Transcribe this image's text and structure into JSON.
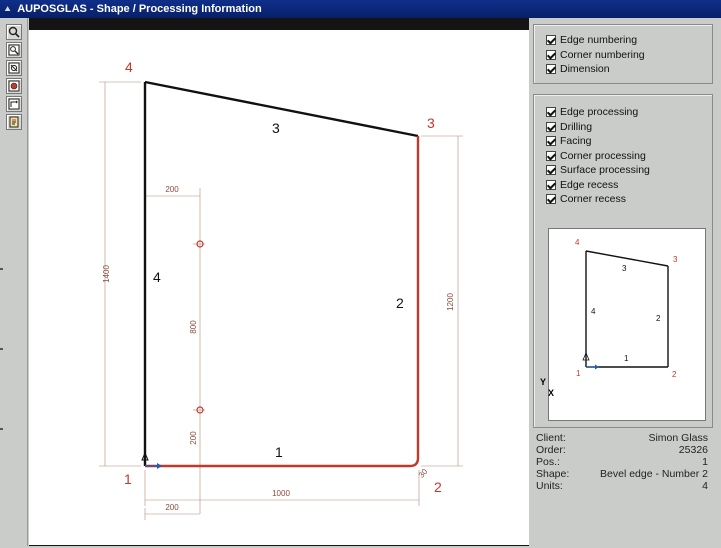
{
  "window": {
    "title": "AUPOSGLAS - Shape / Processing Information"
  },
  "toolbar": {
    "tools": [
      {
        "icon": "zoom-icon"
      },
      {
        "icon": "zoom-window-icon"
      },
      {
        "icon": "zoom-fit-icon"
      },
      {
        "icon": "zoom-shape-icon"
      },
      {
        "icon": "zoom-previous-icon"
      },
      {
        "icon": "print-icon"
      }
    ]
  },
  "drawing": {
    "corner_labels": [
      "1",
      "2",
      "3",
      "4"
    ],
    "edge_labels": [
      "1",
      "2",
      "3",
      "4"
    ],
    "dimensions": {
      "bottom_width": "1000",
      "left_height": "1400",
      "right_height": "1200",
      "hole_offset_top": "200",
      "hole_offset_bottom": "200",
      "hole_spacing": "800",
      "hole_vertical_offset": "200",
      "corner_radius": "30"
    },
    "colors": {
      "processed_edge": "#c0392b",
      "outline": "#111111",
      "dimension": "#8a4a3a"
    }
  },
  "display_options": [
    {
      "label": "Edge numbering",
      "checked": true
    },
    {
      "label": "Corner numbering",
      "checked": true
    },
    {
      "label": "Dimension",
      "checked": true
    }
  ],
  "processing_options": [
    {
      "label": "Edge processing",
      "checked": true
    },
    {
      "label": "Drilling",
      "checked": true
    },
    {
      "label": "Facing",
      "checked": true
    },
    {
      "label": "Corner processing",
      "checked": true
    },
    {
      "label": "Surface processing",
      "checked": true
    },
    {
      "label": "Edge recess",
      "checked": true
    },
    {
      "label": "Corner recess",
      "checked": true
    }
  ],
  "preview": {
    "corner_labels": [
      "1",
      "2",
      "3",
      "4"
    ],
    "edge_labels": [
      "1",
      "2",
      "3",
      "4"
    ],
    "axis_y": "Y",
    "axis_x": "X"
  },
  "info": [
    {
      "label": "Client:",
      "value": "Simon Glass"
    },
    {
      "label": "Order:",
      "value": "25326"
    },
    {
      "label": "Pos.:",
      "value": "1"
    },
    {
      "label": "Shape:",
      "value": "Bevel edge - Number 2"
    },
    {
      "label": "Units:",
      "value": "4"
    }
  ]
}
